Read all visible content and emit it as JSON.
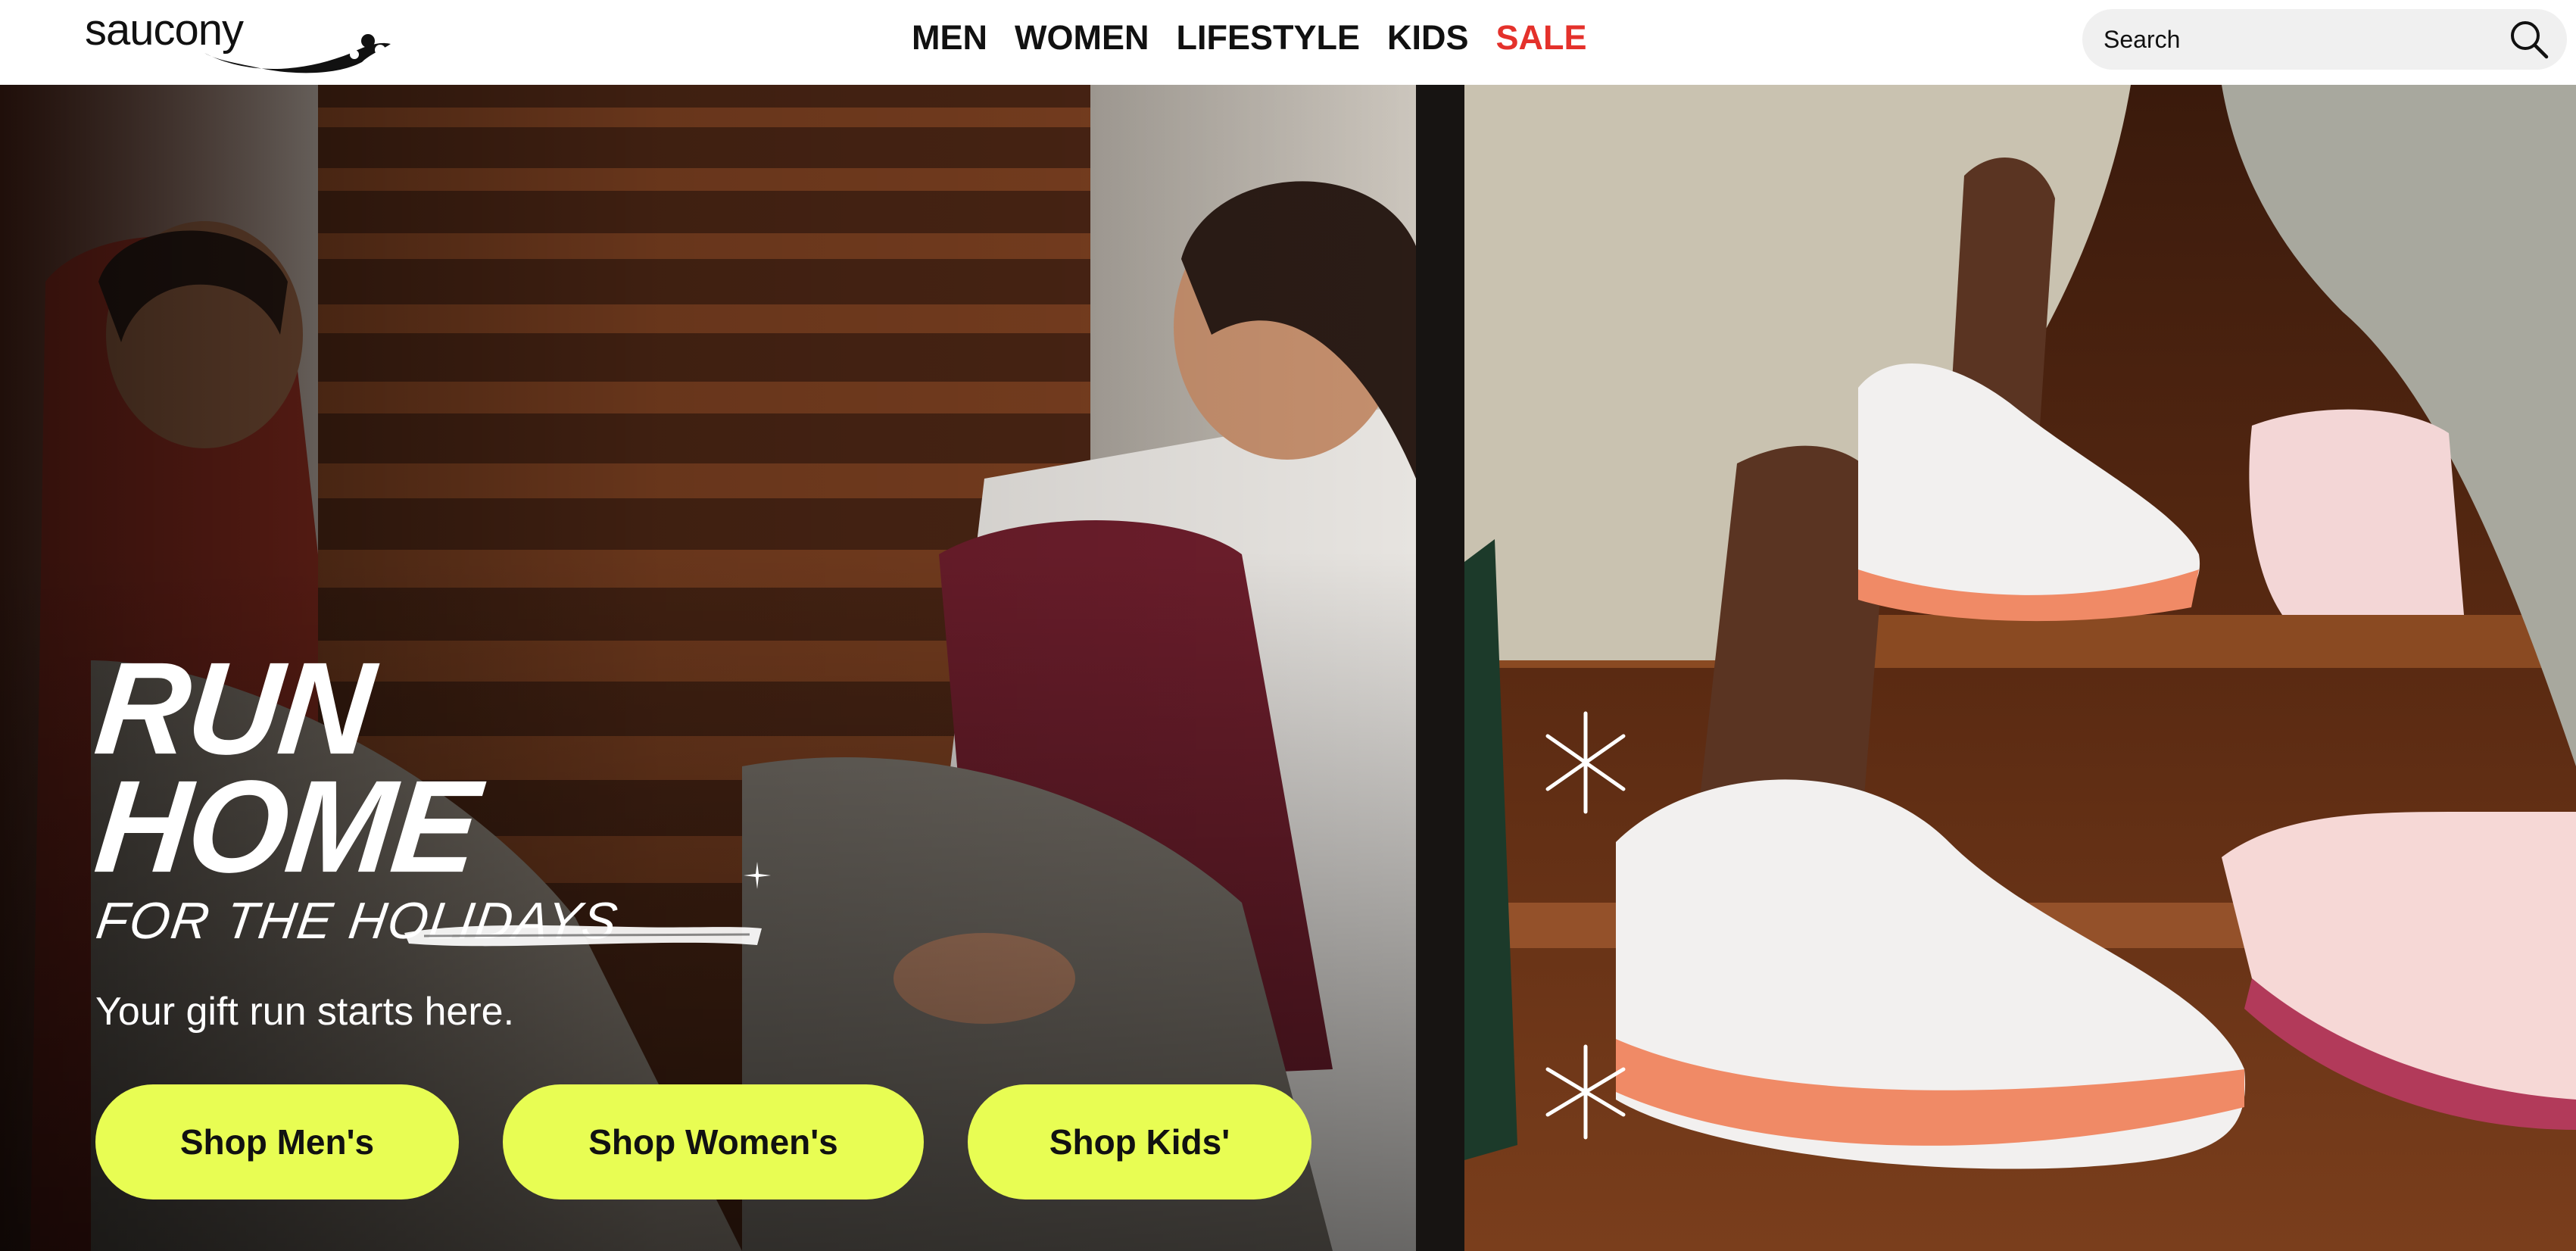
{
  "header": {
    "brand": "saucony",
    "nav": [
      {
        "label": "MEN"
      },
      {
        "label": "WOMEN"
      },
      {
        "label": "LIFESTYLE"
      },
      {
        "label": "KIDS"
      },
      {
        "label": "SALE"
      }
    ],
    "search": {
      "placeholder": "Search"
    }
  },
  "hero": {
    "headline_line1": "RUN",
    "headline_line2": "HOME",
    "headline_line3": "FOR THE HOLIDAYS",
    "tagline": "Your gift run starts here.",
    "buttons": [
      {
        "label": "Shop Men's"
      },
      {
        "label": "Shop Women's"
      },
      {
        "label": "Shop Kids'"
      }
    ]
  },
  "colors": {
    "accent_button": "#e8fd53",
    "sale_red": "#e4312b",
    "text_dark": "#111111"
  },
  "icons": [
    "search-icon",
    "brand-swoosh-icon",
    "sparkle-icon"
  ]
}
